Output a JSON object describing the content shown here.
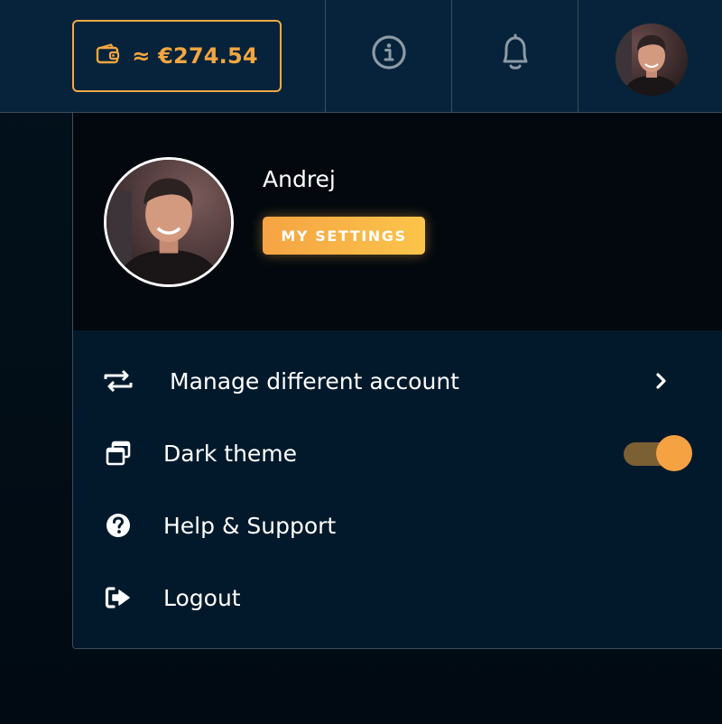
{
  "topbar": {
    "balance": "≈ €274.54",
    "icons": [
      "wallet-icon",
      "info-icon",
      "bell-icon"
    ]
  },
  "profile": {
    "name": "Andrej",
    "settings_label": "MY SETTINGS"
  },
  "menu": {
    "items": [
      {
        "label": "Manage different account",
        "icon": "switch-account-icon"
      },
      {
        "label": "Dark theme",
        "icon": "window-stack-icon",
        "toggle_on": true
      },
      {
        "label": "Help & Support",
        "icon": "question-circle-icon"
      },
      {
        "label": "Logout",
        "icon": "logout-icon"
      }
    ]
  },
  "colors": {
    "accent": "#f4a640",
    "topbar_bg": "#06233b",
    "profile_bg": "#02080e",
    "menu_bg": "#02192c",
    "toggle_track": "#7b6034"
  }
}
